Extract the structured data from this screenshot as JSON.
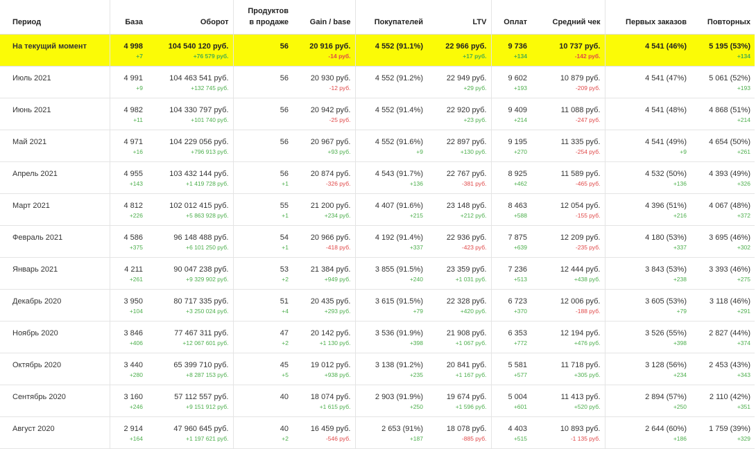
{
  "headers": {
    "period": "Период",
    "base": "База",
    "turnover": "Оборот",
    "products_line1": "Продуктов",
    "products_line2": "в продаже",
    "gain": "Gain / base",
    "buyers": "Покупателей",
    "ltv": "LTV",
    "payments": "Оплат",
    "avg_check": "Средний чек",
    "first_orders": "Первых заказов",
    "repeat": "Повторных"
  },
  "current": {
    "period": "На текущий момент",
    "base": "4 998",
    "base_d": "+7",
    "turnover": "104 540 120 руб.",
    "turnover_d": "+76 579 руб.",
    "products": "56",
    "products_d": "",
    "gain": "20 916 руб.",
    "gain_d": "-14 руб.",
    "buyers": "4 552 (91.1%)",
    "buyers_d": "",
    "ltv": "22 966 руб.",
    "ltv_d": "+17 руб.",
    "payments": "9 736",
    "payments_d": "+134",
    "avg_check": "10 737 руб.",
    "avg_check_d": "-142 руб.",
    "first_orders": "4 541 (46%)",
    "first_orders_d": "",
    "repeat": "5 195 (53%)",
    "repeat_d": "+134"
  },
  "rows": [
    {
      "period": "Июль 2021",
      "base": "4 991",
      "base_d": "+9",
      "turnover": "104 463 541 руб.",
      "turnover_d": "+132 745 руб.",
      "products": "56",
      "products_d": "",
      "gain": "20 930 руб.",
      "gain_d": "-12 руб.",
      "buyers": "4 552 (91.2%)",
      "buyers_d": "",
      "ltv": "22 949 руб.",
      "ltv_d": "+29 руб.",
      "payments": "9 602",
      "payments_d": "+193",
      "avg_check": "10 879 руб.",
      "avg_check_d": "-209 руб.",
      "first_orders": "4 541 (47%)",
      "first_orders_d": "",
      "repeat": "5 061 (52%)",
      "repeat_d": "+193"
    },
    {
      "period": "Июнь 2021",
      "base": "4 982",
      "base_d": "+11",
      "turnover": "104 330 797 руб.",
      "turnover_d": "+101 740 руб.",
      "products": "56",
      "products_d": "",
      "gain": "20 942 руб.",
      "gain_d": "-25 руб.",
      "buyers": "4 552 (91.4%)",
      "buyers_d": "",
      "ltv": "22 920 руб.",
      "ltv_d": "+23 руб.",
      "payments": "9 409",
      "payments_d": "+214",
      "avg_check": "11 088 руб.",
      "avg_check_d": "-247 руб.",
      "first_orders": "4 541 (48%)",
      "first_orders_d": "",
      "repeat": "4 868 (51%)",
      "repeat_d": "+214"
    },
    {
      "period": "Май 2021",
      "base": "4 971",
      "base_d": "+16",
      "turnover": "104 229 056 руб.",
      "turnover_d": "+796 913 руб.",
      "products": "56",
      "products_d": "",
      "gain": "20 967 руб.",
      "gain_d": "+93 руб.",
      "buyers": "4 552 (91.6%)",
      "buyers_d": "+9",
      "ltv": "22 897 руб.",
      "ltv_d": "+130 руб.",
      "payments": "9 195",
      "payments_d": "+270",
      "avg_check": "11 335 руб.",
      "avg_check_d": "-254 руб.",
      "first_orders": "4 541 (49%)",
      "first_orders_d": "+9",
      "repeat": "4 654 (50%)",
      "repeat_d": "+261"
    },
    {
      "period": "Апрель 2021",
      "base": "4 955",
      "base_d": "+143",
      "turnover": "103 432 144 руб.",
      "turnover_d": "+1 419 728 руб.",
      "products": "56",
      "products_d": "+1",
      "gain": "20 874 руб.",
      "gain_d": "-326 руб.",
      "buyers": "4 543 (91.7%)",
      "buyers_d": "+136",
      "ltv": "22 767 руб.",
      "ltv_d": "-381 руб.",
      "payments": "8 925",
      "payments_d": "+462",
      "avg_check": "11 589 руб.",
      "avg_check_d": "-465 руб.",
      "first_orders": "4 532 (50%)",
      "first_orders_d": "+136",
      "repeat": "4 393 (49%)",
      "repeat_d": "+326"
    },
    {
      "period": "Март 2021",
      "base": "4 812",
      "base_d": "+226",
      "turnover": "102 012 415 руб.",
      "turnover_d": "+5 863 928 руб.",
      "products": "55",
      "products_d": "+1",
      "gain": "21 200 руб.",
      "gain_d": "+234 руб.",
      "buyers": "4 407 (91.6%)",
      "buyers_d": "+215",
      "ltv": "23 148 руб.",
      "ltv_d": "+212 руб.",
      "payments": "8 463",
      "payments_d": "+588",
      "avg_check": "12 054 руб.",
      "avg_check_d": "-155 руб.",
      "first_orders": "4 396 (51%)",
      "first_orders_d": "+216",
      "repeat": "4 067 (48%)",
      "repeat_d": "+372"
    },
    {
      "period": "Февраль 2021",
      "base": "4 586",
      "base_d": "+375",
      "turnover": "96 148 488 руб.",
      "turnover_d": "+6 101 250 руб.",
      "products": "54",
      "products_d": "+1",
      "gain": "20 966 руб.",
      "gain_d": "-418 руб.",
      "buyers": "4 192 (91.4%)",
      "buyers_d": "+337",
      "ltv": "22 936 руб.",
      "ltv_d": "-423 руб.",
      "payments": "7 875",
      "payments_d": "+639",
      "avg_check": "12 209 руб.",
      "avg_check_d": "-235 руб.",
      "first_orders": "4 180 (53%)",
      "first_orders_d": "+337",
      "repeat": "3 695 (46%)",
      "repeat_d": "+302"
    },
    {
      "period": "Январь 2021",
      "base": "4 211",
      "base_d": "+261",
      "turnover": "90 047 238 руб.",
      "turnover_d": "+9 329 902 руб.",
      "products": "53",
      "products_d": "+2",
      "gain": "21 384 руб.",
      "gain_d": "+949 руб.",
      "buyers": "3 855 (91.5%)",
      "buyers_d": "+240",
      "ltv": "23 359 руб.",
      "ltv_d": "+1 031 руб.",
      "payments": "7 236",
      "payments_d": "+513",
      "avg_check": "12 444 руб.",
      "avg_check_d": "+438 руб.",
      "first_orders": "3 843 (53%)",
      "first_orders_d": "+238",
      "repeat": "3 393 (46%)",
      "repeat_d": "+275"
    },
    {
      "period": "Декабрь 2020",
      "base": "3 950",
      "base_d": "+104",
      "turnover": "80 717 335 руб.",
      "turnover_d": "+3 250 024 руб.",
      "products": "51",
      "products_d": "+4",
      "gain": "20 435 руб.",
      "gain_d": "+293 руб.",
      "buyers": "3 615 (91.5%)",
      "buyers_d": "+79",
      "ltv": "22 328 руб.",
      "ltv_d": "+420 руб.",
      "payments": "6 723",
      "payments_d": "+370",
      "avg_check": "12 006 руб.",
      "avg_check_d": "-188 руб.",
      "first_orders": "3 605 (53%)",
      "first_orders_d": "+79",
      "repeat": "3 118 (46%)",
      "repeat_d": "+291"
    },
    {
      "period": "Ноябрь 2020",
      "base": "3 846",
      "base_d": "+406",
      "turnover": "77 467 311 руб.",
      "turnover_d": "+12 067 601 руб.",
      "products": "47",
      "products_d": "+2",
      "gain": "20 142 руб.",
      "gain_d": "+1 130 руб.",
      "buyers": "3 536 (91.9%)",
      "buyers_d": "+398",
      "ltv": "21 908 руб.",
      "ltv_d": "+1 067 руб.",
      "payments": "6 353",
      "payments_d": "+772",
      "avg_check": "12 194 руб.",
      "avg_check_d": "+476 руб.",
      "first_orders": "3 526 (55%)",
      "first_orders_d": "+398",
      "repeat": "2 827 (44%)",
      "repeat_d": "+374"
    },
    {
      "period": "Октябрь 2020",
      "base": "3 440",
      "base_d": "+280",
      "turnover": "65 399 710 руб.",
      "turnover_d": "+8 287 153 руб.",
      "products": "45",
      "products_d": "+5",
      "gain": "19 012 руб.",
      "gain_d": "+938 руб.",
      "buyers": "3 138 (91.2%)",
      "buyers_d": "+235",
      "ltv": "20 841 руб.",
      "ltv_d": "+1 167 руб.",
      "payments": "5 581",
      "payments_d": "+577",
      "avg_check": "11 718 руб.",
      "avg_check_d": "+305 руб.",
      "first_orders": "3 128 (56%)",
      "first_orders_d": "+234",
      "repeat": "2 453 (43%)",
      "repeat_d": "+343"
    },
    {
      "period": "Сентябрь 2020",
      "base": "3 160",
      "base_d": "+246",
      "turnover": "57 112 557 руб.",
      "turnover_d": "+9 151 912 руб.",
      "products": "40",
      "products_d": "",
      "gain": "18 074 руб.",
      "gain_d": "+1 615 руб.",
      "buyers": "2 903 (91.9%)",
      "buyers_d": "+250",
      "ltv": "19 674 руб.",
      "ltv_d": "+1 596 руб.",
      "payments": "5 004",
      "payments_d": "+601",
      "avg_check": "11 413 руб.",
      "avg_check_d": "+520 руб.",
      "first_orders": "2 894 (57%)",
      "first_orders_d": "+250",
      "repeat": "2 110 (42%)",
      "repeat_d": "+351"
    },
    {
      "period": "Август 2020",
      "base": "2 914",
      "base_d": "+164",
      "turnover": "47 960 645 руб.",
      "turnover_d": "+1 197 621 руб.",
      "products": "40",
      "products_d": "+2",
      "gain": "16 459 руб.",
      "gain_d": "-546 руб.",
      "buyers": "2 653 (91%)",
      "buyers_d": "+187",
      "ltv": "18 078 руб.",
      "ltv_d": "-885 руб.",
      "payments": "4 403",
      "payments_d": "+515",
      "avg_check": "10 893 руб.",
      "avg_check_d": "-1 135 руб.",
      "first_orders": "2 644 (60%)",
      "first_orders_d": "+186",
      "repeat": "1 759 (39%)",
      "repeat_d": "+329"
    }
  ]
}
